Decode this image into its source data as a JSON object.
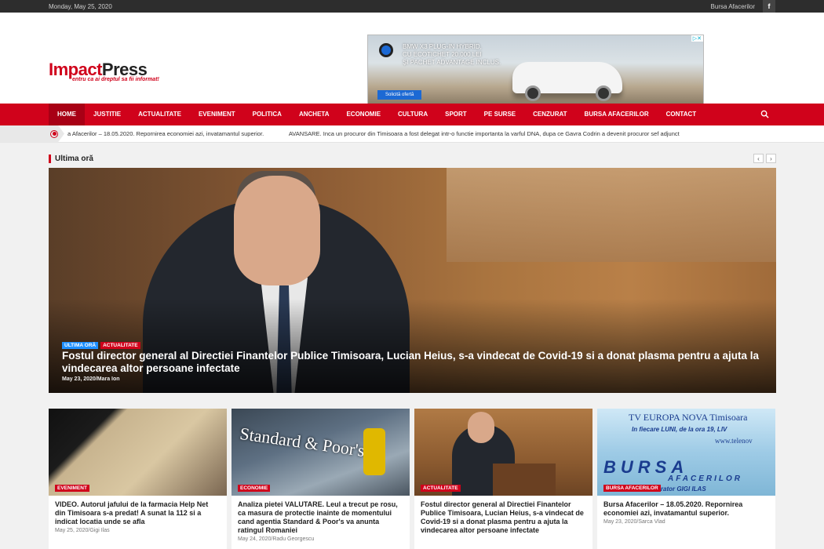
{
  "topbar": {
    "date": "Monday, May 25, 2020",
    "link": "Bursa Afacerilor",
    "social": "f"
  },
  "logo": {
    "impact": "Impact",
    "press": "Press",
    "tagline": "entru ca ai dreptul sa fii informat!"
  },
  "ad": {
    "line1": "BMW X3 PLUG-IN HYBRID,",
    "line2": "CU ECOTICHET 20.000 LEI",
    "line3": "ȘI PACHET ADVANTAGE INCLUS.",
    "button": "Solicită ofertă",
    "badge": "▷✕"
  },
  "nav": {
    "items": [
      "HOME",
      "JUSTITIE",
      "ACTUALITATE",
      "EVENIMENT",
      "POLITICA",
      "ANCHETA",
      "ECONOMIE",
      "CULTURA",
      "SPORT",
      "PE SURSE",
      "CENZURAT",
      "BURSA AFACERILOR",
      "CONTACT"
    ],
    "active": "HOME"
  },
  "ticker": {
    "items": [
      "a Afacerilor – 18.05.2020. Repornirea economiei azi, invatamantul superior.",
      "AVANSARE. Inca un procuror din Timisoara a fost delegat intr-o functie importanta la varful DNA, dupa ce Gavra Codrin a devenit procuror sef adjunct"
    ]
  },
  "section": {
    "title": "Ultima oră",
    "prev": "‹",
    "next": "›"
  },
  "hero": {
    "cat1": "ULTIMA ORĂ",
    "cat2": "ACTUALITATE",
    "title": "Fostul director general al Directiei Finantelor Publice Timisoara, Lucian Heius, s-a vindecat de Covid-19 si a donat plasma pentru a ajuta la vindecarea altor persoane infectate",
    "meta": "May 23, 2020/Mara Ion"
  },
  "cards": [
    {
      "cat": "EVENIMENT",
      "title": "VIDEO. Autorul jafului de la farmacia Help Net din Timisoara s-a predat! A sunat la 112 si a indicat locatia unde se afla",
      "meta": "May 25, 2020/Gigi Ilas"
    },
    {
      "cat": "ECONOMIE",
      "title": "Analiza pietei VALUTARE. Leul a trecut pe rosu, ca masura de protectie inainte de momentului cand agentia Standard & Poor's va anunta ratingul Romaniei",
      "meta": "May 24, 2020/Radu Georgescu",
      "img_text": "Standard & Poor's"
    },
    {
      "cat": "ACTUALITATE",
      "title": "Fostul director general al Directiei Finantelor Publice Timisoara, Lucian Heius, s-a vindecat de Covid-19 si a donat plasma pentru a ajuta la vindecarea altor persoane infectate",
      "meta": ""
    },
    {
      "cat": "BURSA AFACERILOR",
      "title": "Bursa Afacerilor – 18.05.2020. Repornirea economiei azi, invatamantul superior.",
      "meta": "May 23, 2020/Sarca Vlad",
      "img": {
        "t1": "TV EUROPA NOVA Timisoara",
        "t2": "In fiecare LUNI, de la ora 19, LIV",
        "t3": "www.telenov",
        "t4": "BURSA",
        "t5": "AFACERILOR",
        "t6": "Moderator GIGI ILAS"
      }
    }
  ]
}
